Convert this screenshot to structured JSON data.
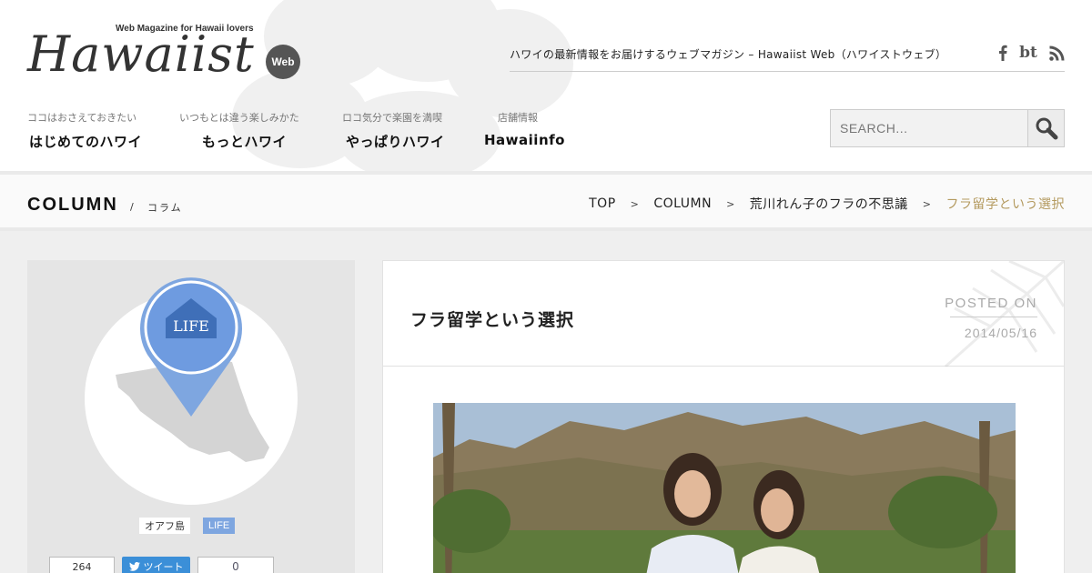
{
  "header": {
    "logo_tagline": "Web Magazine for Hawaii lovers",
    "logo_text": "Hawaiist",
    "logo_badge": "Web",
    "site_description": "ハワイの最新情報をお届けするウェブマガジン – Hawaiist Web（ハワイストウェブ）",
    "social": [
      {
        "name": "facebook",
        "icon": "facebook-icon"
      },
      {
        "name": "bt",
        "label": "bt",
        "icon": "bt-icon"
      },
      {
        "name": "rss",
        "icon": "rss-icon"
      }
    ]
  },
  "nav": [
    {
      "sub": "ココはおさえておきたい",
      "label": "はじめてのハワイ"
    },
    {
      "sub": "いつもとは違う楽しみかた",
      "label": "もっとハワイ"
    },
    {
      "sub": "ロコ気分で楽園を満喫",
      "label": "やっぱりハワイ"
    },
    {
      "sub": "店舗情報",
      "label": "Hawaiinfo"
    }
  ],
  "search": {
    "placeholder": "SEARCH...",
    "icon": "search-icon"
  },
  "section": {
    "title": "COLUMN",
    "slash": "/",
    "subtitle": "コラム"
  },
  "breadcrumb": {
    "items": [
      "TOP",
      "COLUMN",
      "荒川れん子のフラの不思議",
      "フラ留学という選択"
    ],
    "separator": ">"
  },
  "sidebar": {
    "pin_label": "LIFE",
    "tags": [
      "オアフ島",
      "LIFE"
    ],
    "share": {
      "count": "264",
      "tweet_label": "ツイート",
      "other_count": "0"
    }
  },
  "article": {
    "title": "フラ留学という選択",
    "posted_label": "POSTED ON",
    "posted_date": "2014/05/16"
  },
  "colors": {
    "accent_gold": "#b49a5f",
    "pin_blue": "#7ea6e0",
    "tweet_blue": "#3b8fd8"
  }
}
